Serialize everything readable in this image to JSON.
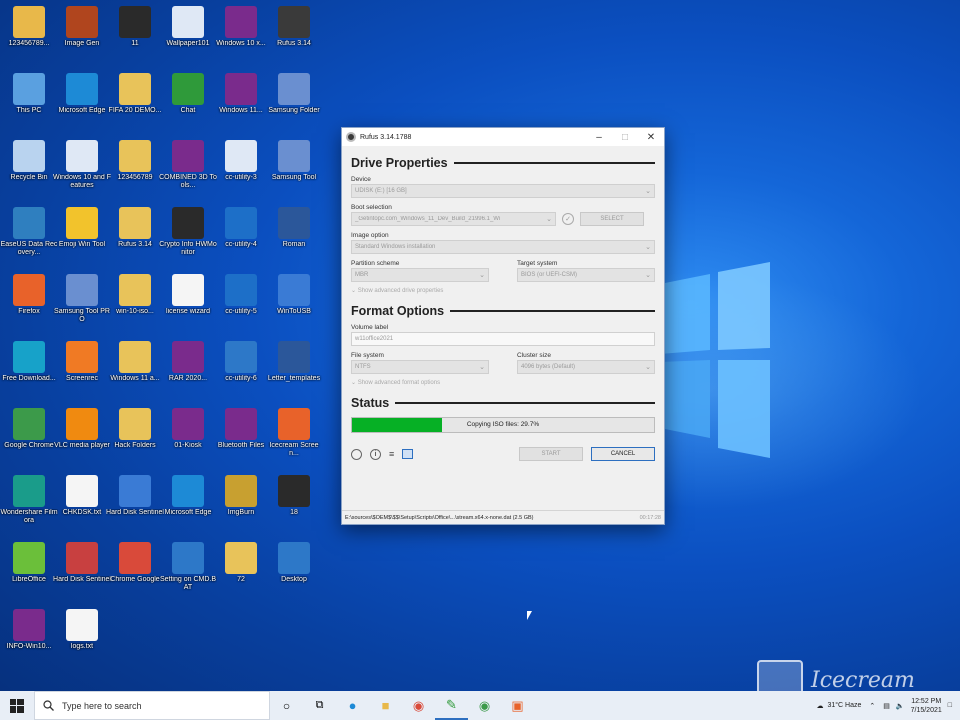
{
  "desktop": {
    "icons": [
      {
        "label": "123456789...",
        "icon": "folder-user-icon",
        "color": "#e8b84a"
      },
      {
        "label": "Image Gen",
        "icon": "image-app-icon",
        "color": "#b0451e"
      },
      {
        "label": "11",
        "icon": "folder-dark-icon",
        "color": "#2a2a2a"
      },
      {
        "label": "Wallpaper101",
        "icon": "notepad-icon",
        "color": "#dfe8f5"
      },
      {
        "label": "Windows 10 x...",
        "icon": "winrar-icon",
        "color": "#7a2b8c"
      },
      {
        "label": "Rufus 3.14",
        "icon": "usb-drive-icon",
        "color": "#3a3a3a"
      },
      {
        "label": "This PC",
        "icon": "computer-icon",
        "color": "#5aa0e0"
      },
      {
        "label": "Microsoft Edge",
        "icon": "edge-icon",
        "color": "#1d8ad6"
      },
      {
        "label": "FIFA 20 DEMO...",
        "icon": "folder-file-icon",
        "color": "#e8c35a"
      },
      {
        "label": "Chat",
        "icon": "leaf-app-icon",
        "color": "#2f9a3a"
      },
      {
        "label": "Windows 11...",
        "icon": "winrar-icon",
        "color": "#7a2b8c"
      },
      {
        "label": "Samsung Folder",
        "icon": "gear-app-icon",
        "color": "#6a8fd0"
      },
      {
        "label": "Recycle Bin",
        "icon": "recycle-bin-icon",
        "color": "#b9d3ef"
      },
      {
        "label": "Windows 10 and Features",
        "icon": "monitor-app-icon",
        "color": "#dfe8f5"
      },
      {
        "label": "123456789",
        "icon": "folder-icon",
        "color": "#e8c35a"
      },
      {
        "label": "COMBINED 3D Tools...",
        "icon": "winrar-icon",
        "color": "#7a2b8c"
      },
      {
        "label": "cc-utility-3",
        "icon": "window-app-icon",
        "color": "#dfe8f5"
      },
      {
        "label": "Samsung Tool",
        "icon": "gear-app-icon",
        "color": "#6a8fd0"
      },
      {
        "label": "EaseUS Data Recovery...",
        "icon": "recovery-app-icon",
        "color": "#2f7fbf"
      },
      {
        "label": "Emoji Win Tool",
        "icon": "emoji-icon",
        "color": "#f2c32c"
      },
      {
        "label": "Rufus 3.14",
        "icon": "folder-icon",
        "color": "#e8c35a"
      },
      {
        "label": "Crypto Info HWMonitor",
        "icon": "hwmonitor-icon",
        "color": "#2a2a2a"
      },
      {
        "label": "cc-utility-4",
        "icon": "window-app-icon",
        "color": "#1d6fc8"
      },
      {
        "label": "Roman",
        "icon": "word-icon",
        "color": "#2b579a"
      },
      {
        "label": "Firefox",
        "icon": "firefox-icon",
        "color": "#e8622a"
      },
      {
        "label": "Samsung Tool PRO",
        "icon": "gear-app-icon",
        "color": "#6a8fd0"
      },
      {
        "label": "win-10-iso...",
        "icon": "folder-icon",
        "color": "#e8c35a"
      },
      {
        "label": "license wizard",
        "icon": "document-icon",
        "color": "#f5f5f5"
      },
      {
        "label": "cc-utility-5",
        "icon": "window-app-icon",
        "color": "#1d6fc8"
      },
      {
        "label": "WinToUSB",
        "icon": "wintousb-icon",
        "color": "#3a7bd5"
      },
      {
        "label": "Free Download...",
        "icon": "download-app-icon",
        "color": "#17a2c9"
      },
      {
        "label": "Screenrec",
        "icon": "camera-app-icon",
        "color": "#f07a24"
      },
      {
        "label": "Windows 11 a...",
        "icon": "folder-icon",
        "color": "#e8c35a"
      },
      {
        "label": "RAR 2020...",
        "icon": "winrar-icon",
        "color": "#7a2b8c"
      },
      {
        "label": "cc-utility-6",
        "icon": "pdf-app-icon",
        "color": "#2d78c8"
      },
      {
        "label": "Letter_templates",
        "icon": "word-icon",
        "color": "#2b579a"
      },
      {
        "label": "Google Chrome",
        "icon": "chrome-icon",
        "color": "#3c9a4a"
      },
      {
        "label": "VLC media player",
        "icon": "vlc-icon",
        "color": "#f08a10"
      },
      {
        "label": "Hack Folders",
        "icon": "folder-file-icon",
        "color": "#e8c35a"
      },
      {
        "label": "01-Kiosk",
        "icon": "winrar-icon",
        "color": "#7a2b8c"
      },
      {
        "label": "Bluetooth Files",
        "icon": "winrar-icon",
        "color": "#7a2b8c"
      },
      {
        "label": "Icecream Screen...",
        "icon": "icecream-icon",
        "color": "#e8622a"
      },
      {
        "label": "Wondershare Filmora",
        "icon": "filmora-icon",
        "color": "#1a9c8a"
      },
      {
        "label": "CHKDSK.txt",
        "icon": "text-file-icon",
        "color": "#f5f5f5"
      },
      {
        "label": "Hard Disk Sentinel",
        "icon": "harddisk-app-icon",
        "color": "#3a7bd5"
      },
      {
        "label": "Microsoft Edge",
        "icon": "edge-icon",
        "color": "#1d8ad6"
      },
      {
        "label": "ImgBurn",
        "icon": "disc-app-icon",
        "color": "#c8a030"
      },
      {
        "label": "18",
        "icon": "phone-folder-icon",
        "color": "#2a2a2a"
      },
      {
        "label": "LibreOffice",
        "icon": "cube-app-icon",
        "color": "#6bbf3a"
      },
      {
        "label": "Hard Disk Sentinel",
        "icon": "harddisk-app-icon",
        "color": "#c84040"
      },
      {
        "label": "Chrome Google",
        "icon": "chrome-icon",
        "color": "#d94a3a"
      },
      {
        "label": "Setting on CMD.BAT",
        "icon": "settings-bat-icon",
        "color": "#2d78c8"
      },
      {
        "label": "72",
        "icon": "folder-file-icon",
        "color": "#e8c35a"
      },
      {
        "label": "Desktop",
        "icon": "shortcut-icon",
        "color": "#2d78c8"
      },
      {
        "label": "INFO-Win10...",
        "icon": "winrar-icon",
        "color": "#7a2b8c"
      },
      {
        "label": "logs.txt",
        "icon": "text-file-icon",
        "color": "#f5f5f5"
      }
    ]
  },
  "rufus": {
    "title": "Rufus 3.14.1788",
    "drive_properties": {
      "heading": "Drive Properties",
      "device_label": "Device",
      "device_value": "UDISK (E:) [16 GB]",
      "boot_label": "Boot selection",
      "boot_value": "_Getintopc.com_Windows_11_Dev_Build_21996.1_Wi",
      "select_button": "SELECT",
      "image_option_label": "Image option",
      "image_option_value": "Standard Windows installation",
      "partition_label": "Partition scheme",
      "partition_value": "MBR",
      "target_label": "Target system",
      "target_value": "BIOS (or UEFI-CSM)",
      "advanced_toggle": "Show advanced drive properties"
    },
    "format_options": {
      "heading": "Format Options",
      "volume_label": "Volume label",
      "volume_value": "w11office2021",
      "filesystem_label": "File system",
      "filesystem_value": "NTFS",
      "cluster_label": "Cluster size",
      "cluster_value": "4096 bytes (Default)",
      "advanced_toggle": "Show advanced format options"
    },
    "status": {
      "heading": "Status",
      "progress_text": "Copying ISO files: 29.7%",
      "progress_percent": 29.7,
      "start_button": "START",
      "cancel_button": "CANCEL"
    },
    "statusbar": {
      "path": "E:\\sources\\$OEM$\\$$\\Setup\\Scripts\\Office\\...\\stream.x64.x-none.dat (2.5 GB)",
      "elapsed": "00:17:28"
    }
  },
  "taskbar": {
    "search_placeholder": "Type here to search",
    "weather": "31°C  Haze",
    "time": "12:52 PM",
    "date": "7/15/2021"
  },
  "watermark": {
    "text": "Icecream"
  }
}
